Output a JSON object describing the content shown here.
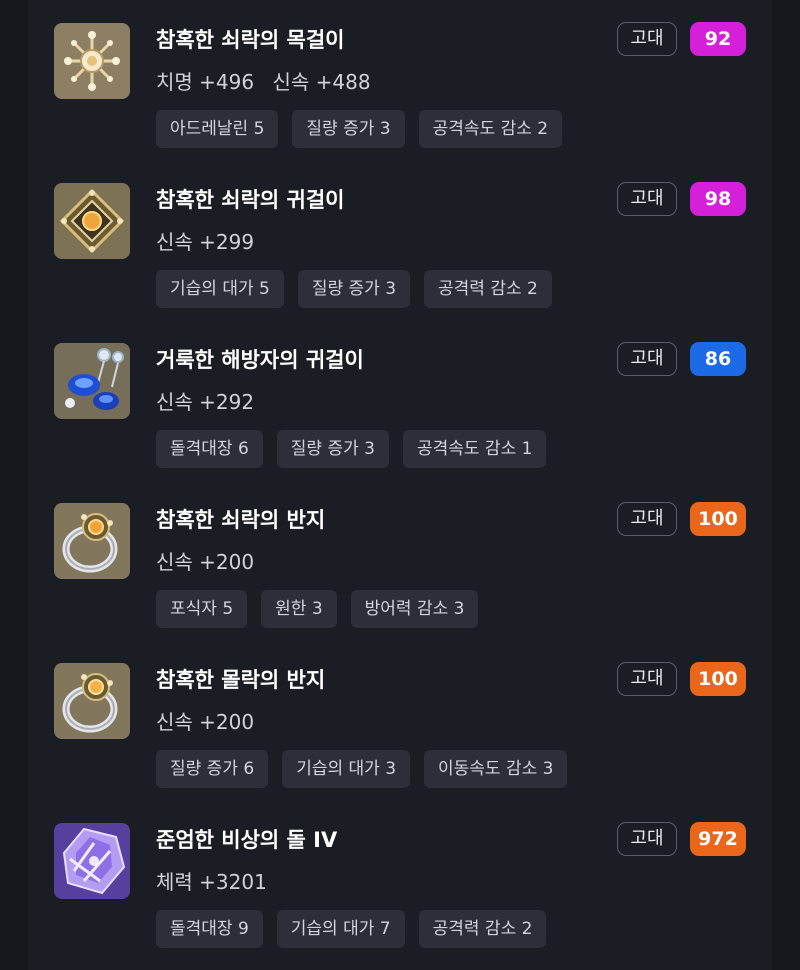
{
  "items": [
    {
      "name": "참혹한 쇠락의 목걸이",
      "stats": [
        "치명 +496",
        "신속 +488"
      ],
      "tags": [
        "아드레날린 5",
        "질량 증가 3",
        "공격속도 감소 2"
      ],
      "grade": "고대",
      "quality": "92",
      "quality_color": "#d520d9",
      "icon": "necklace-icon"
    },
    {
      "name": "참혹한 쇠락의 귀걸이",
      "stats": [
        "신속 +299"
      ],
      "tags": [
        "기습의 대가 5",
        "질량 증가 3",
        "공격력 감소 2"
      ],
      "grade": "고대",
      "quality": "98",
      "quality_color": "#d520d9",
      "icon": "earring-icon"
    },
    {
      "name": "거룩한 해방자의 귀걸이",
      "stats": [
        "신속 +292"
      ],
      "tags": [
        "돌격대장 6",
        "질량 증가 3",
        "공격속도 감소 1"
      ],
      "grade": "고대",
      "quality": "86",
      "quality_color": "#1d6ae6",
      "icon": "blue-earring-icon"
    },
    {
      "name": "참혹한 쇠락의 반지",
      "stats": [
        "신속 +200"
      ],
      "tags": [
        "포식자 5",
        "원한 3",
        "방어력 감소 3"
      ],
      "grade": "고대",
      "quality": "100",
      "quality_color": "#e9661a",
      "icon": "ring-icon"
    },
    {
      "name": "참혹한 몰락의 반지",
      "stats": [
        "신속 +200"
      ],
      "tags": [
        "질량 증가 6",
        "기습의 대가 3",
        "이동속도 감소 3"
      ],
      "grade": "고대",
      "quality": "100",
      "quality_color": "#e9661a",
      "icon": "ring-icon"
    },
    {
      "name": "준엄한 비상의 돌 IV",
      "stats": [
        "체력 +3201"
      ],
      "tags": [
        "돌격대장 9",
        "기습의 대가 7",
        "공격력 감소 2"
      ],
      "grade": "고대",
      "quality": "972",
      "quality_color": "#e9661a",
      "icon": "ability-stone-icon"
    }
  ]
}
